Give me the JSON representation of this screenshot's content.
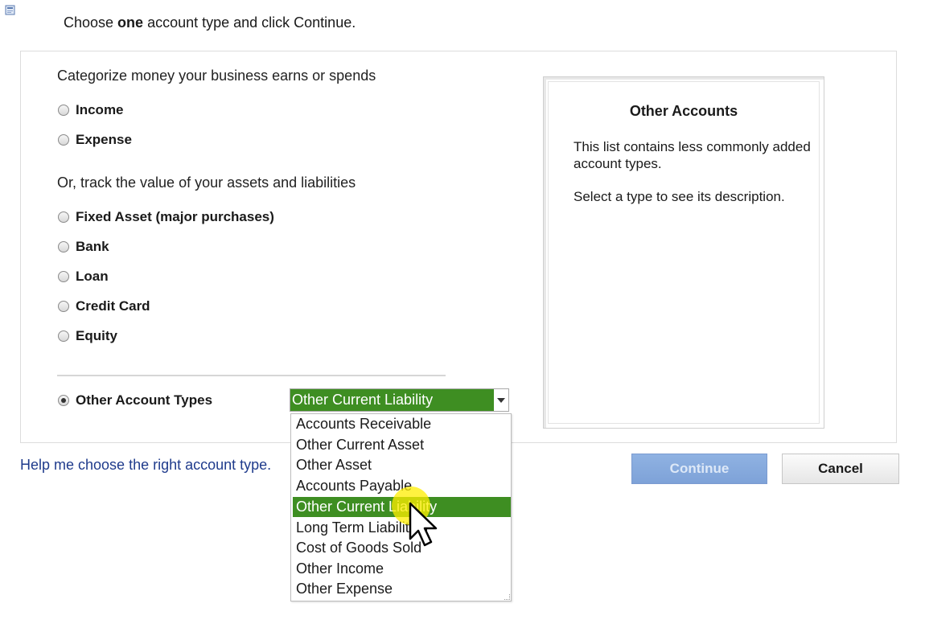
{
  "header": {
    "prefix": "Choose ",
    "emphasis": "one",
    "suffix": " account type and click Continue."
  },
  "categorize": {
    "label": "Categorize money your business earns or spends",
    "options": [
      "Income",
      "Expense"
    ]
  },
  "track": {
    "label": "Or, track the value of your assets and liabilities",
    "options": [
      "Fixed Asset (major purchases)",
      "Bank",
      "Loan",
      "Credit Card",
      "Equity"
    ]
  },
  "other": {
    "label": "Other Account Types",
    "selected_value": "Other Current Liability",
    "dropdown_items": [
      "Accounts Receivable",
      "Other Current Asset",
      "Other Asset",
      "Accounts Payable",
      "Other Current Liability",
      "Long Term Liabilities",
      "Cost of Goods Sold",
      "Other Income",
      "Other Expense"
    ],
    "highlighted_index": 4
  },
  "description": {
    "title": "Other Accounts",
    "text": "This list contains less commonly added account types.",
    "hint": "Select a type to see its description."
  },
  "help_link": "Help me choose the right account type.",
  "buttons": {
    "continue": "Continue",
    "cancel": "Cancel"
  },
  "colors": {
    "selection_green": "#3e8e22",
    "link_blue": "#1f3b8c",
    "continue_bg": "#8fb2e2"
  }
}
